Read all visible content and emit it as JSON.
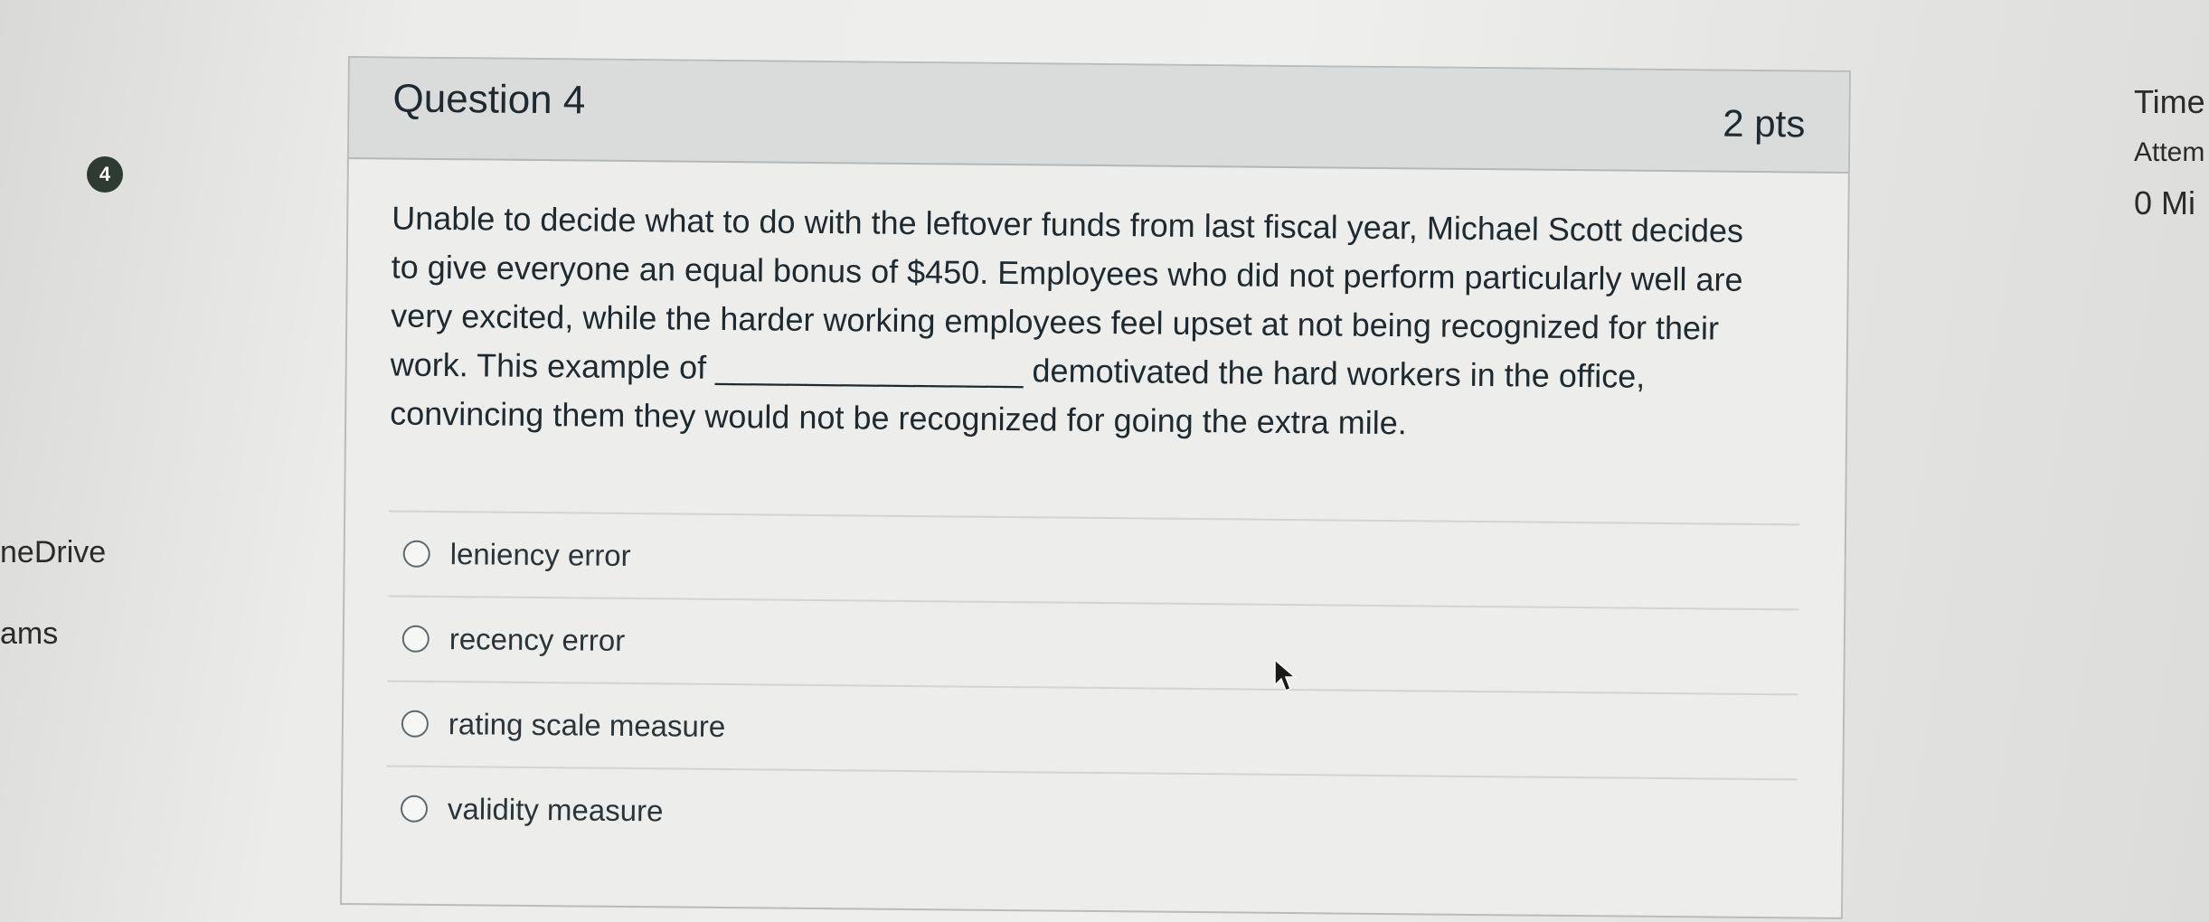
{
  "left_nav": {
    "items": [
      {
        "label": "neDrive"
      },
      {
        "label": "ams"
      }
    ]
  },
  "badge": {
    "number": "4"
  },
  "question": {
    "title": "Question 4",
    "points": "2 pts",
    "text_lines": [
      "Unable to decide what to do with the leftover funds from last fiscal year, Michael Scott decides",
      "to give everyone an equal bonus of $450.  Employees who did not perform particularly well are",
      "very excited, while the harder working employees feel upset at not being recognized for their",
      "work.  This example of _________________ demotivated the hard workers in the office,",
      "convincing them they would not be recognized for going the extra mile."
    ],
    "answers": [
      {
        "label": "leniency error"
      },
      {
        "label": "recency error"
      },
      {
        "label": "rating scale measure"
      },
      {
        "label": "validity measure"
      }
    ]
  },
  "right_panel": {
    "time_label": "Time",
    "attempt_label": "Attem",
    "minutes_label": "0 Mi"
  },
  "icons": {
    "cursor": "mouse-pointer-icon"
  }
}
